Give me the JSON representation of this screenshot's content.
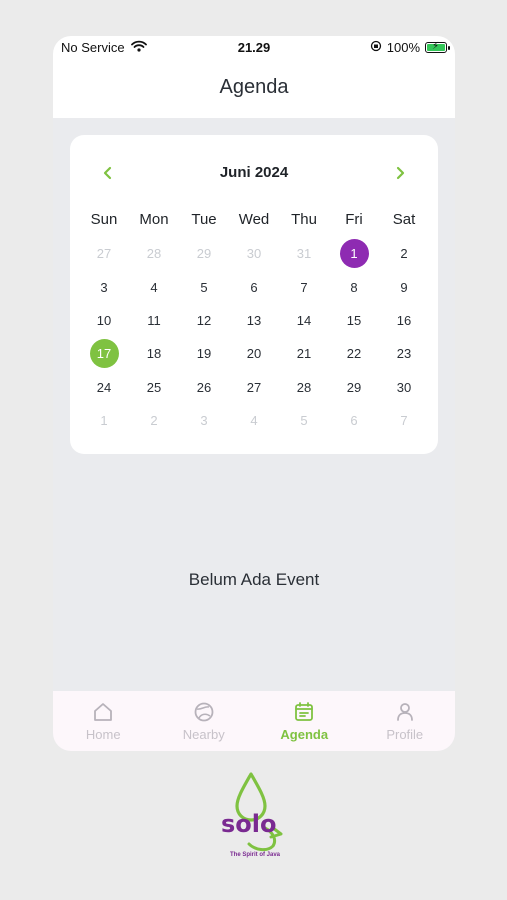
{
  "status": {
    "carrier": "No Service",
    "time": "21.29",
    "battery": "100%"
  },
  "header": {
    "title": "Agenda"
  },
  "calendar": {
    "month_label": "Juni 2024",
    "weekdays": [
      "Sun",
      "Mon",
      "Tue",
      "Wed",
      "Thu",
      "Fri",
      "Sat"
    ],
    "weeks": [
      [
        [
          "27",
          "muted"
        ],
        [
          "28",
          "muted"
        ],
        [
          "29",
          "muted"
        ],
        [
          "30",
          "muted"
        ],
        [
          "31",
          "muted"
        ],
        [
          "1",
          "event"
        ],
        [
          "2",
          ""
        ]
      ],
      [
        [
          "3",
          ""
        ],
        [
          "4",
          ""
        ],
        [
          "5",
          ""
        ],
        [
          "6",
          ""
        ],
        [
          "7",
          ""
        ],
        [
          "8",
          ""
        ],
        [
          "9",
          ""
        ]
      ],
      [
        [
          "10",
          ""
        ],
        [
          "11",
          ""
        ],
        [
          "12",
          ""
        ],
        [
          "13",
          ""
        ],
        [
          "14",
          ""
        ],
        [
          "15",
          ""
        ],
        [
          "16",
          ""
        ]
      ],
      [
        [
          "17",
          "today"
        ],
        [
          "18",
          ""
        ],
        [
          "19",
          ""
        ],
        [
          "20",
          ""
        ],
        [
          "21",
          ""
        ],
        [
          "22",
          ""
        ],
        [
          "23",
          ""
        ]
      ],
      [
        [
          "24",
          ""
        ],
        [
          "25",
          ""
        ],
        [
          "26",
          ""
        ],
        [
          "27",
          ""
        ],
        [
          "28",
          ""
        ],
        [
          "29",
          ""
        ],
        [
          "30",
          ""
        ]
      ],
      [
        [
          "1",
          "muted"
        ],
        [
          "2",
          "muted"
        ],
        [
          "3",
          "muted"
        ],
        [
          "4",
          "muted"
        ],
        [
          "5",
          "muted"
        ],
        [
          "6",
          "muted"
        ],
        [
          "7",
          "muted"
        ]
      ]
    ],
    "colors": {
      "event": "#8e2bb2",
      "today": "#7fc241",
      "accent": "#7fc241"
    }
  },
  "empty_state": "Belum Ada Event",
  "tabs": [
    {
      "label": "Home",
      "icon": "home-icon",
      "active": false
    },
    {
      "label": "Nearby",
      "icon": "globe-icon",
      "active": false
    },
    {
      "label": "Agenda",
      "icon": "calendar-icon",
      "active": true
    },
    {
      "label": "Profile",
      "icon": "person-icon",
      "active": false
    }
  ],
  "logo": {
    "text": "solo",
    "tagline": "The Spirit of Java"
  }
}
